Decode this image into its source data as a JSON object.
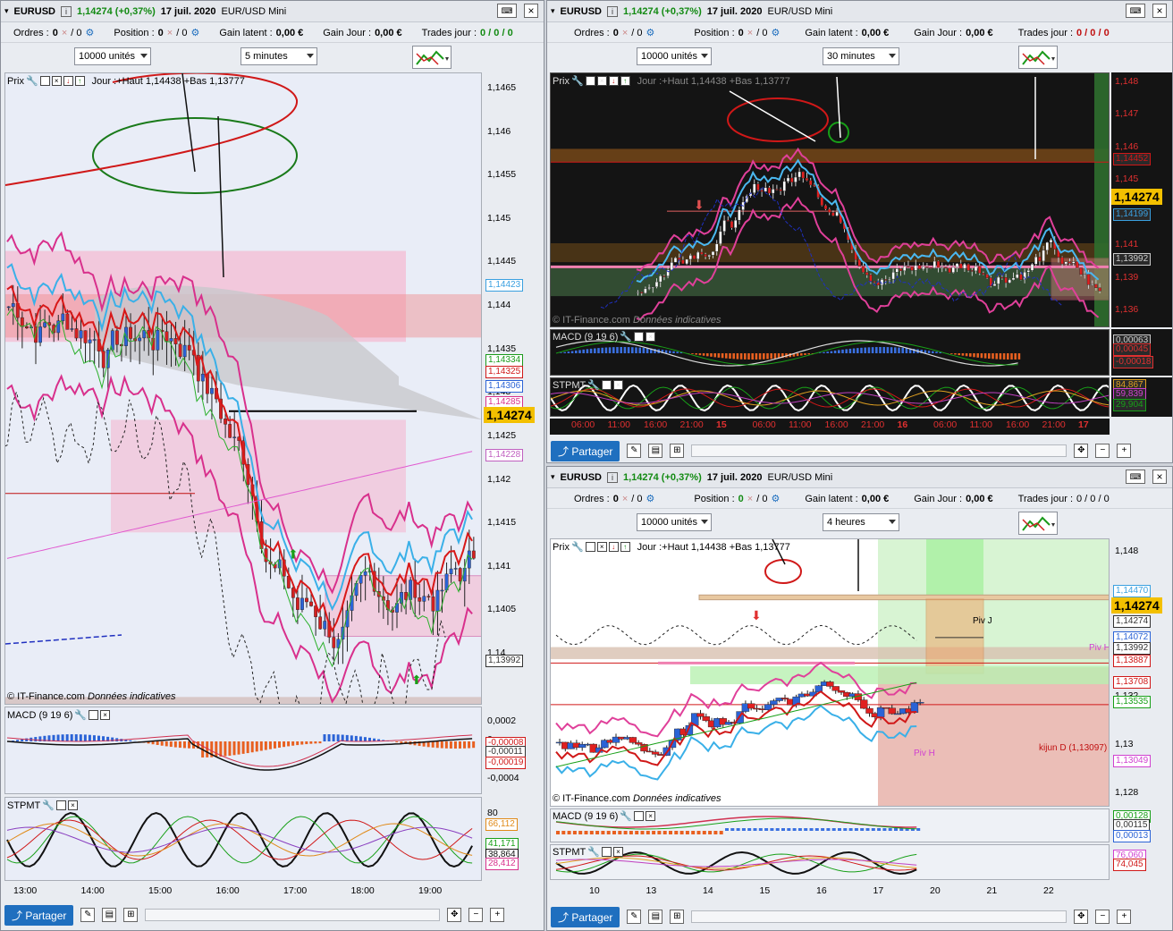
{
  "common": {
    "symbol": "EURUSD",
    "change": "1,14274 (+0,37%)",
    "date": "17 juil. 2020",
    "instrument": "EUR/USD Mini",
    "orders_label": "Ordres :",
    "orders_val": "0",
    "orders_sep": "/ 0",
    "position_label": "Position :",
    "position_val": "0",
    "position_sep": "/ 0",
    "latent_label": "Gain latent :",
    "latent_val": "0,00 €",
    "jour_label": "Gain Jour :",
    "jour_val": "0,00 €",
    "trades_label": "Trades jour :",
    "trades_val": "0 / 0 / 0",
    "units": "10000 unités",
    "share": "Partager",
    "copyright": "© IT-Finance.com",
    "indicative": "Données indicatives",
    "prix": "Prix",
    "macd": "MACD (9 19 6)",
    "stpmt": "STPMT",
    "last_price": "1,14274",
    "day_range": "Jour :+Haut 1,14438 +Bas 1,13777",
    "day_range_4h": "Jour :+Haut 1,14438 +Bas 1,13777",
    "colors": {
      "up": "#128a12",
      "down": "#c01010",
      "last": "#f3c000",
      "share": "#1f6fbf"
    }
  },
  "w1": {
    "timeframe": "5 minutes",
    "price_ticks": [
      "1,1465",
      "1,146",
      "1,1455",
      "1,145",
      "1,1445",
      "1,144",
      "1,1435",
      "1,143",
      "1,1425",
      "1,142",
      "1,1415",
      "1,141",
      "1,1405",
      "1,14"
    ],
    "price_labels": [
      "1,14423",
      "1,14334",
      "1,14325",
      "1,14306",
      "1,14285",
      "1,14228",
      "1,13992"
    ],
    "macd_ticks": [
      "0,0002",
      "0",
      "-0,0002",
      "-0,0004"
    ],
    "macd_labels": [
      "-0,00008",
      "-0,00011",
      "-0,00019"
    ],
    "stpmt_ticks": [
      "80"
    ],
    "stpmt_labels": [
      "66,112",
      "41,171",
      "38,864",
      "28,412"
    ],
    "time_ticks": [
      "13:00",
      "14:00",
      "15:00",
      "16:00",
      "17:00",
      "18:00",
      "19:00"
    ]
  },
  "w2": {
    "timeframe": "30 minutes",
    "price_ticks": [
      "1,148",
      "1,147",
      "1,146",
      "1,145",
      "1,144",
      "1,141",
      "1,139",
      "1,136"
    ],
    "price_labels": [
      "1,14452",
      "1,14199",
      "1,13992"
    ],
    "macd_labels": [
      "0,00063",
      "0,00045",
      "-0,00018"
    ],
    "stpmt_labels": [
      "84,867",
      "59,839",
      "29,904"
    ],
    "time_ticks": [
      "06:00",
      "11:00",
      "16:00",
      "21:00",
      "15",
      "06:00",
      "11:00",
      "16:00",
      "21:00",
      "16",
      "06:00",
      "11:00",
      "16:00",
      "21:00",
      "17"
    ]
  },
  "w3": {
    "timeframe": "4 heures",
    "price_ticks": [
      "1,148",
      "1,146",
      "1,134",
      "1,132",
      "1,13",
      "1,128"
    ],
    "price_labels": [
      "1,14470",
      "1,14274",
      "1,14072",
      "1,13992",
      "1,13887",
      "1,13708",
      "1,13535",
      "1,13049"
    ],
    "macd_labels": [
      "0,00128",
      "0,00115",
      "0,00013"
    ],
    "stpmt_labels": [
      "76,060",
      "74,045"
    ],
    "time_ticks": [
      "10",
      "13",
      "14",
      "15",
      "16",
      "17",
      "20",
      "21",
      "22"
    ],
    "piv_j": "Piv J",
    "piv_h": "Piv H",
    "piv_h2": "Piv H",
    "kijun": "kijun D (1,13097)"
  }
}
